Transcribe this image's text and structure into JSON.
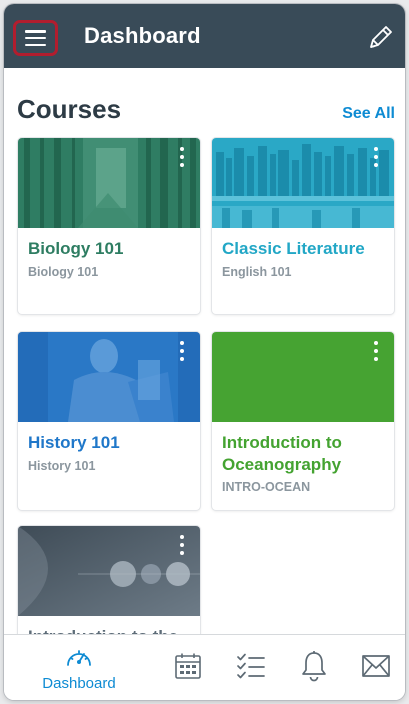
{
  "appbar": {
    "title": "Dashboard",
    "menu_icon": "hamburger-menu-icon",
    "edit_icon": "pencil-icon"
  },
  "courses_section": {
    "title": "Courses",
    "see_all_label": "See All"
  },
  "courses": [
    {
      "name": "Biology 101",
      "code": "Biology 101",
      "color": "#2e7d62",
      "image": "forest"
    },
    {
      "name": "Classic Literature",
      "code": "English 101",
      "color": "#22a7c6",
      "image": "bookshelf"
    },
    {
      "name": "History 101",
      "code": "History 101",
      "color": "#1f77c9",
      "image": "monument"
    },
    {
      "name": "Introduction to Oceanography",
      "code": "INTRO-OCEAN",
      "color": "#44a331",
      "image": "solid"
    },
    {
      "name": "Introduction to the",
      "code": "",
      "color": "#5d6c78",
      "image": "planets"
    }
  ],
  "tabbar": {
    "items": [
      {
        "label": "Dashboard",
        "icon": "dashboard-gauge-icon",
        "active": true
      },
      {
        "label": "",
        "icon": "calendar-icon",
        "active": false
      },
      {
        "label": "",
        "icon": "todo-checklist-icon",
        "active": false
      },
      {
        "label": "",
        "icon": "notification-bell-icon",
        "active": false
      },
      {
        "label": "",
        "icon": "inbox-envelope-icon",
        "active": false
      }
    ]
  },
  "colors": {
    "appbar": "#394b58",
    "accent": "#0e8bd3",
    "highlight_border": "#b21d2e",
    "inactive_icon": "#5d6a74"
  }
}
